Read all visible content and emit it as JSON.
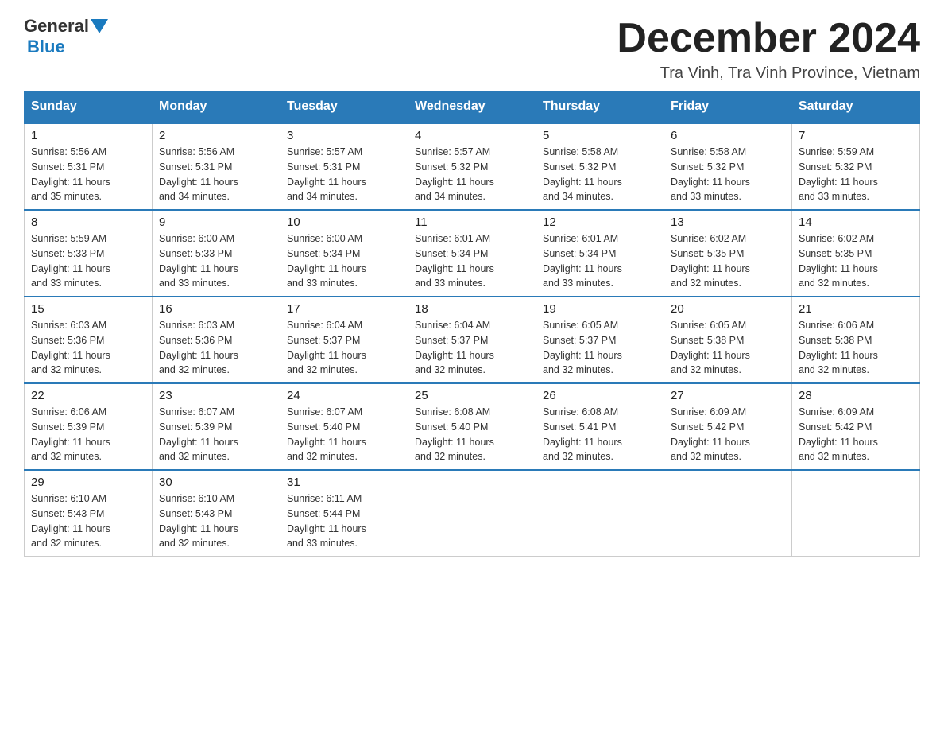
{
  "header": {
    "logo_general": "General",
    "logo_blue": "Blue",
    "month_title": "December 2024",
    "location": "Tra Vinh, Tra Vinh Province, Vietnam"
  },
  "days_of_week": [
    "Sunday",
    "Monday",
    "Tuesday",
    "Wednesday",
    "Thursday",
    "Friday",
    "Saturday"
  ],
  "weeks": [
    [
      {
        "day": "1",
        "sunrise": "5:56 AM",
        "sunset": "5:31 PM",
        "daylight": "11 hours and 35 minutes."
      },
      {
        "day": "2",
        "sunrise": "5:56 AM",
        "sunset": "5:31 PM",
        "daylight": "11 hours and 34 minutes."
      },
      {
        "day": "3",
        "sunrise": "5:57 AM",
        "sunset": "5:31 PM",
        "daylight": "11 hours and 34 minutes."
      },
      {
        "day": "4",
        "sunrise": "5:57 AM",
        "sunset": "5:32 PM",
        "daylight": "11 hours and 34 minutes."
      },
      {
        "day": "5",
        "sunrise": "5:58 AM",
        "sunset": "5:32 PM",
        "daylight": "11 hours and 34 minutes."
      },
      {
        "day": "6",
        "sunrise": "5:58 AM",
        "sunset": "5:32 PM",
        "daylight": "11 hours and 33 minutes."
      },
      {
        "day": "7",
        "sunrise": "5:59 AM",
        "sunset": "5:32 PM",
        "daylight": "11 hours and 33 minutes."
      }
    ],
    [
      {
        "day": "8",
        "sunrise": "5:59 AM",
        "sunset": "5:33 PM",
        "daylight": "11 hours and 33 minutes."
      },
      {
        "day": "9",
        "sunrise": "6:00 AM",
        "sunset": "5:33 PM",
        "daylight": "11 hours and 33 minutes."
      },
      {
        "day": "10",
        "sunrise": "6:00 AM",
        "sunset": "5:34 PM",
        "daylight": "11 hours and 33 minutes."
      },
      {
        "day": "11",
        "sunrise": "6:01 AM",
        "sunset": "5:34 PM",
        "daylight": "11 hours and 33 minutes."
      },
      {
        "day": "12",
        "sunrise": "6:01 AM",
        "sunset": "5:34 PM",
        "daylight": "11 hours and 33 minutes."
      },
      {
        "day": "13",
        "sunrise": "6:02 AM",
        "sunset": "5:35 PM",
        "daylight": "11 hours and 32 minutes."
      },
      {
        "day": "14",
        "sunrise": "6:02 AM",
        "sunset": "5:35 PM",
        "daylight": "11 hours and 32 minutes."
      }
    ],
    [
      {
        "day": "15",
        "sunrise": "6:03 AM",
        "sunset": "5:36 PM",
        "daylight": "11 hours and 32 minutes."
      },
      {
        "day": "16",
        "sunrise": "6:03 AM",
        "sunset": "5:36 PM",
        "daylight": "11 hours and 32 minutes."
      },
      {
        "day": "17",
        "sunrise": "6:04 AM",
        "sunset": "5:37 PM",
        "daylight": "11 hours and 32 minutes."
      },
      {
        "day": "18",
        "sunrise": "6:04 AM",
        "sunset": "5:37 PM",
        "daylight": "11 hours and 32 minutes."
      },
      {
        "day": "19",
        "sunrise": "6:05 AM",
        "sunset": "5:37 PM",
        "daylight": "11 hours and 32 minutes."
      },
      {
        "day": "20",
        "sunrise": "6:05 AM",
        "sunset": "5:38 PM",
        "daylight": "11 hours and 32 minutes."
      },
      {
        "day": "21",
        "sunrise": "6:06 AM",
        "sunset": "5:38 PM",
        "daylight": "11 hours and 32 minutes."
      }
    ],
    [
      {
        "day": "22",
        "sunrise": "6:06 AM",
        "sunset": "5:39 PM",
        "daylight": "11 hours and 32 minutes."
      },
      {
        "day": "23",
        "sunrise": "6:07 AM",
        "sunset": "5:39 PM",
        "daylight": "11 hours and 32 minutes."
      },
      {
        "day": "24",
        "sunrise": "6:07 AM",
        "sunset": "5:40 PM",
        "daylight": "11 hours and 32 minutes."
      },
      {
        "day": "25",
        "sunrise": "6:08 AM",
        "sunset": "5:40 PM",
        "daylight": "11 hours and 32 minutes."
      },
      {
        "day": "26",
        "sunrise": "6:08 AM",
        "sunset": "5:41 PM",
        "daylight": "11 hours and 32 minutes."
      },
      {
        "day": "27",
        "sunrise": "6:09 AM",
        "sunset": "5:42 PM",
        "daylight": "11 hours and 32 minutes."
      },
      {
        "day": "28",
        "sunrise": "6:09 AM",
        "sunset": "5:42 PM",
        "daylight": "11 hours and 32 minutes."
      }
    ],
    [
      {
        "day": "29",
        "sunrise": "6:10 AM",
        "sunset": "5:43 PM",
        "daylight": "11 hours and 32 minutes."
      },
      {
        "day": "30",
        "sunrise": "6:10 AM",
        "sunset": "5:43 PM",
        "daylight": "11 hours and 32 minutes."
      },
      {
        "day": "31",
        "sunrise": "6:11 AM",
        "sunset": "5:44 PM",
        "daylight": "11 hours and 33 minutes."
      },
      null,
      null,
      null,
      null
    ]
  ],
  "cell_labels": {
    "sunrise": "Sunrise:",
    "sunset": "Sunset:",
    "daylight": "Daylight:"
  }
}
